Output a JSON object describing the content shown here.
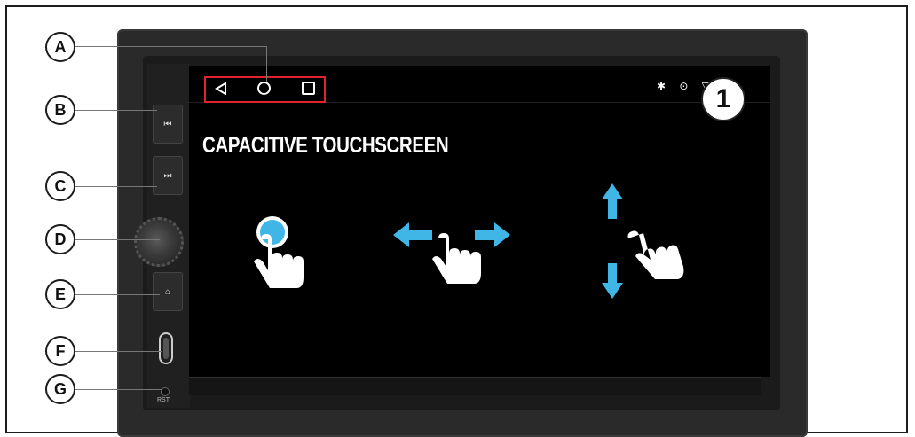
{
  "callouts": [
    "A",
    "B",
    "C",
    "D",
    "E",
    "F",
    "G"
  ],
  "screen": {
    "title": "CAPACITIVE TOUCHSCREEN",
    "badge": "1",
    "status_icons": "✱ ⊙ ▽"
  },
  "reset_label": "RST",
  "icons": {
    "back": "back-triangle-icon",
    "home": "home-circle-icon",
    "recent": "recent-square-icon",
    "prev": "previous-track-icon",
    "next": "next-track-icon",
    "house": "home-icon"
  },
  "colors": {
    "highlight": "#e0242b",
    "gesture_blue": "#3fb6e6"
  }
}
